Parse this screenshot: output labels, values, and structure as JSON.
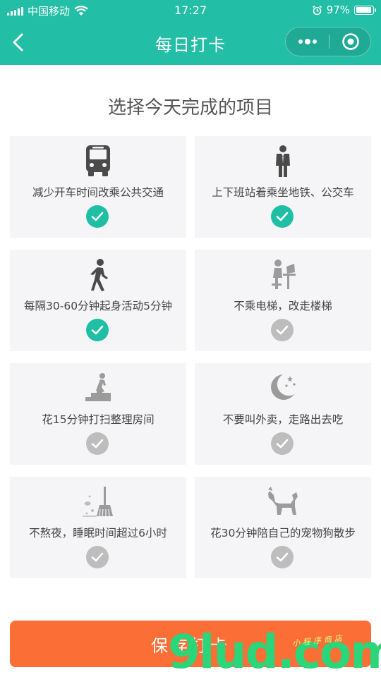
{
  "status_bar": {
    "carrier": "中国移动",
    "time": "17:27",
    "battery_pct": "97%",
    "battery_level": 0.97,
    "icons": [
      "signal-icon",
      "wifi-icon",
      "alarm-icon",
      "battery-icon"
    ]
  },
  "nav": {
    "title": "每日打卡",
    "back_icon": "chevron-left-icon",
    "more_icon": "more-dots-icon",
    "close_icon": "record-circle-icon"
  },
  "heading": "选择今天完成的项目",
  "items": [
    {
      "label": "减少开车时间改乘公共交通",
      "icon": "bus-icon",
      "checked": true
    },
    {
      "label": "上下班站着乘坐地铁、公交车",
      "icon": "standing-person-icon",
      "checked": true
    },
    {
      "label": "每隔30-60分钟起身活动5分钟",
      "icon": "walking-person-icon",
      "checked": true
    },
    {
      "label": "不乘电梯，改走楼梯",
      "icon": "desk-person-icon",
      "checked": false
    },
    {
      "label": "花15分钟打扫整理房间",
      "icon": "stairs-climbing-icon",
      "checked": false
    },
    {
      "label": "不要叫外卖，走路出去吃",
      "icon": "moon-stars-icon",
      "checked": false
    },
    {
      "label": "不熬夜，睡眠时间超过6小时",
      "icon": "broom-icon",
      "checked": false
    },
    {
      "label": "花30分钟陪自己的宠物狗散步",
      "icon": "dog-icon",
      "checked": false
    }
  ],
  "save_button": "保存打卡",
  "watermark": {
    "text": "9lud.com",
    "tagline": "小程序商店"
  },
  "colors": {
    "primary": "#22bea6",
    "check_active": "#1fbfa5",
    "check_inactive": "#bdbdbd",
    "button": "#fb6e36",
    "card_bg": "#f5f5f7",
    "icon_active": "#4a4a4a",
    "icon_inactive": "#9b9b9b"
  }
}
